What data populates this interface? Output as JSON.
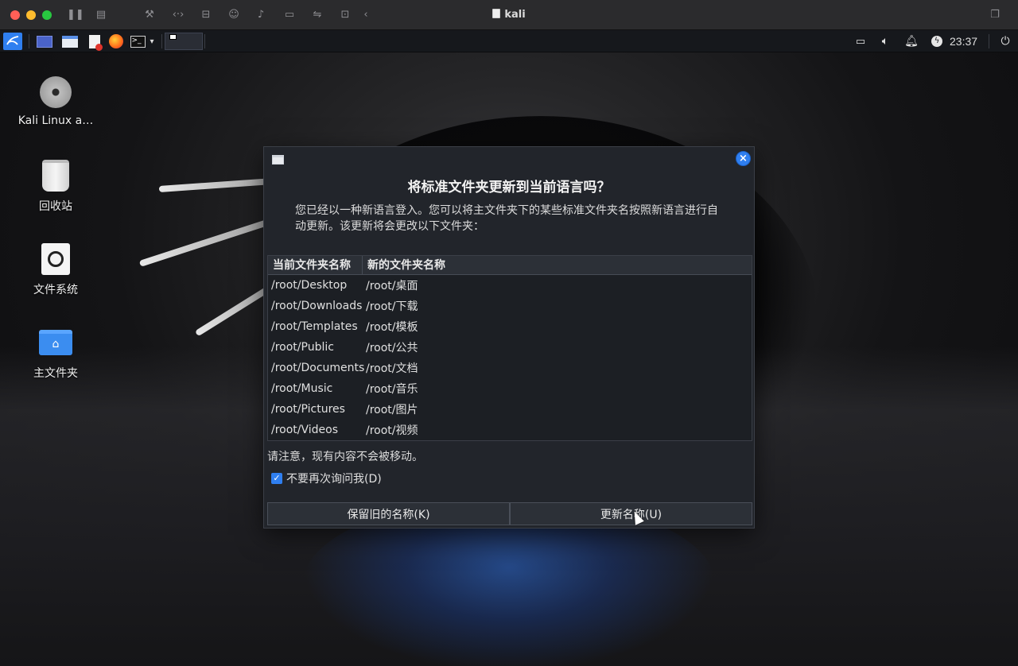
{
  "mac_window": {
    "title": "kali",
    "toolbar_icons": [
      "pause-icon",
      "snapshot-icon",
      "wrench-icon",
      "code-icon",
      "drive-icon",
      "user-icon",
      "sound-icon",
      "camera-icon",
      "usb-icon",
      "folder-share-icon",
      "back-icon",
      "window-icon"
    ]
  },
  "panel": {
    "clock": "23:37",
    "launcher_icons": [
      "kali-menu-icon",
      "desktop-icon",
      "files-icon",
      "text-editor-icon",
      "firefox-icon",
      "terminal-icon",
      "dropdown-icon",
      "workspace-icon"
    ],
    "tray_icons": [
      "network-icon",
      "volume-icon",
      "bell-icon",
      "power-manager-icon",
      "logout-icon"
    ]
  },
  "desktop": {
    "icons": [
      {
        "label": "Kali Linux a…",
        "icon": "disc-icon"
      },
      {
        "label": "回收站",
        "icon": "trash-icon"
      },
      {
        "label": "文件系统",
        "icon": "drive-icon"
      },
      {
        "label": "主文件夹",
        "icon": "home-folder-icon"
      }
    ]
  },
  "dialog": {
    "title": "将标准文件夹更新到当前语言吗？",
    "message": "您已经以一种新语言登入。您可以将主文件夹下的某些标准文件夹名按照新语言进行自动更新。该更新将会更改以下文件夹：",
    "columns": [
      "当前文件夹名称",
      "新的文件夹名称"
    ],
    "rows": [
      [
        "/root/Desktop",
        "/root/桌面"
      ],
      [
        "/root/Downloads",
        "/root/下载"
      ],
      [
        "/root/Templates",
        "/root/模板"
      ],
      [
        "/root/Public",
        "/root/公共"
      ],
      [
        "/root/Documents",
        "/root/文档"
      ],
      [
        "/root/Music",
        "/root/音乐"
      ],
      [
        "/root/Pictures",
        "/root/图片"
      ],
      [
        "/root/Videos",
        "/root/视频"
      ]
    ],
    "note": "请注意，现有内容不会被移动。",
    "checkbox_label": "不要再次询问我(D)",
    "checkbox_checked": true,
    "keep_button": "保留旧的名称(K)",
    "update_button": "更新名称(U)",
    "close_icon": "close-icon"
  },
  "colors": {
    "accent": "#2f7ff0",
    "dialog_bg": "#22252b",
    "panel_bg": "#16181c"
  }
}
